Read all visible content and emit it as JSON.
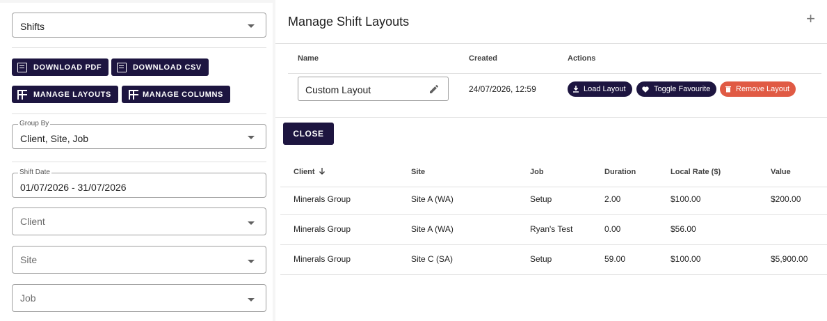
{
  "left": {
    "report_select": {
      "value": "Shifts"
    },
    "buttons": {
      "download_pdf": "DOWNLOAD PDF",
      "download_csv": "DOWNLOAD CSV",
      "manage_layouts": "MANAGE LAYOUTS",
      "manage_columns": "MANAGE COLUMNS"
    },
    "group_by": {
      "label": "Group By",
      "value": "Client, Site, Job"
    },
    "shift_date": {
      "label": "Shift Date",
      "value": "01/07/2026 - 31/07/2026"
    },
    "client": {
      "placeholder": "Client"
    },
    "site": {
      "placeholder": "Site"
    },
    "job": {
      "placeholder": "Job"
    }
  },
  "dialog": {
    "title": "Manage Shift Layouts",
    "add_icon": "plus-icon",
    "columns": {
      "name": "Name",
      "created": "Created",
      "actions": "Actions"
    },
    "layout": {
      "name": "Custom Layout",
      "created": "24/07/2026, 12:59",
      "load": "Load Layout",
      "favourite": "Toggle Favourite",
      "remove": "Remove Layout"
    },
    "close": "CLOSE"
  },
  "grid": {
    "headers": [
      "Client",
      "Site",
      "Job",
      "Duration",
      "Local Rate ($)",
      "Value"
    ],
    "sort_icon": "arrow-down-icon",
    "rows": [
      [
        "Minerals Group",
        "Site A (WA)",
        "Setup",
        "2.00",
        "$100.00",
        "$200.00"
      ],
      [
        "Minerals Group",
        "Site A (WA)",
        "Ryan's Test",
        "0.00",
        "$56.00",
        ""
      ],
      [
        "Minerals Group",
        "Site C (SA)",
        "Setup",
        "59.00",
        "$100.00",
        "$5,900.00"
      ]
    ]
  },
  "colors": {
    "primary": "#1d1540",
    "danger": "#e05a44",
    "border": "#9e9e9e"
  }
}
